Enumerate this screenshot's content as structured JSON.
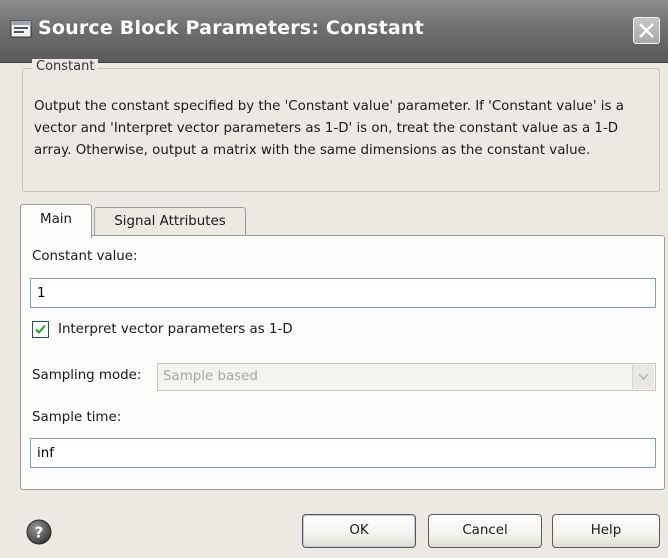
{
  "window": {
    "title": "Source Block Parameters: Constant",
    "close_icon": "close-icon"
  },
  "group": {
    "legend": "Constant",
    "description": "Output the constant specified by the 'Constant value' parameter. If 'Constant value' is a vector and 'Interpret vector parameters as 1-D' is on, treat the constant value as a 1-D array. Otherwise, output a matrix with the same dimensions as the constant value."
  },
  "tabs": [
    {
      "label": "Main",
      "selected": true
    },
    {
      "label": "Signal Attributes",
      "selected": false
    }
  ],
  "main": {
    "constant_value_label": "Constant value:",
    "constant_value": "1",
    "interpret_label": "Interpret vector parameters as 1-D",
    "interpret_checked": true,
    "sampling_mode_label": "Sampling mode:",
    "sampling_mode_value": "Sample based",
    "sampling_mode_enabled": false,
    "sample_time_label": "Sample time:",
    "sample_time_value": "inf"
  },
  "buttons": {
    "ok": "OK",
    "cancel": "Cancel",
    "help": "Help"
  },
  "colors": {
    "titlebar": "#6f6f6f",
    "dialog_bg": "#ece9e2",
    "panel_bg": "#fbfbf9",
    "input_border": "#7f9db9"
  }
}
